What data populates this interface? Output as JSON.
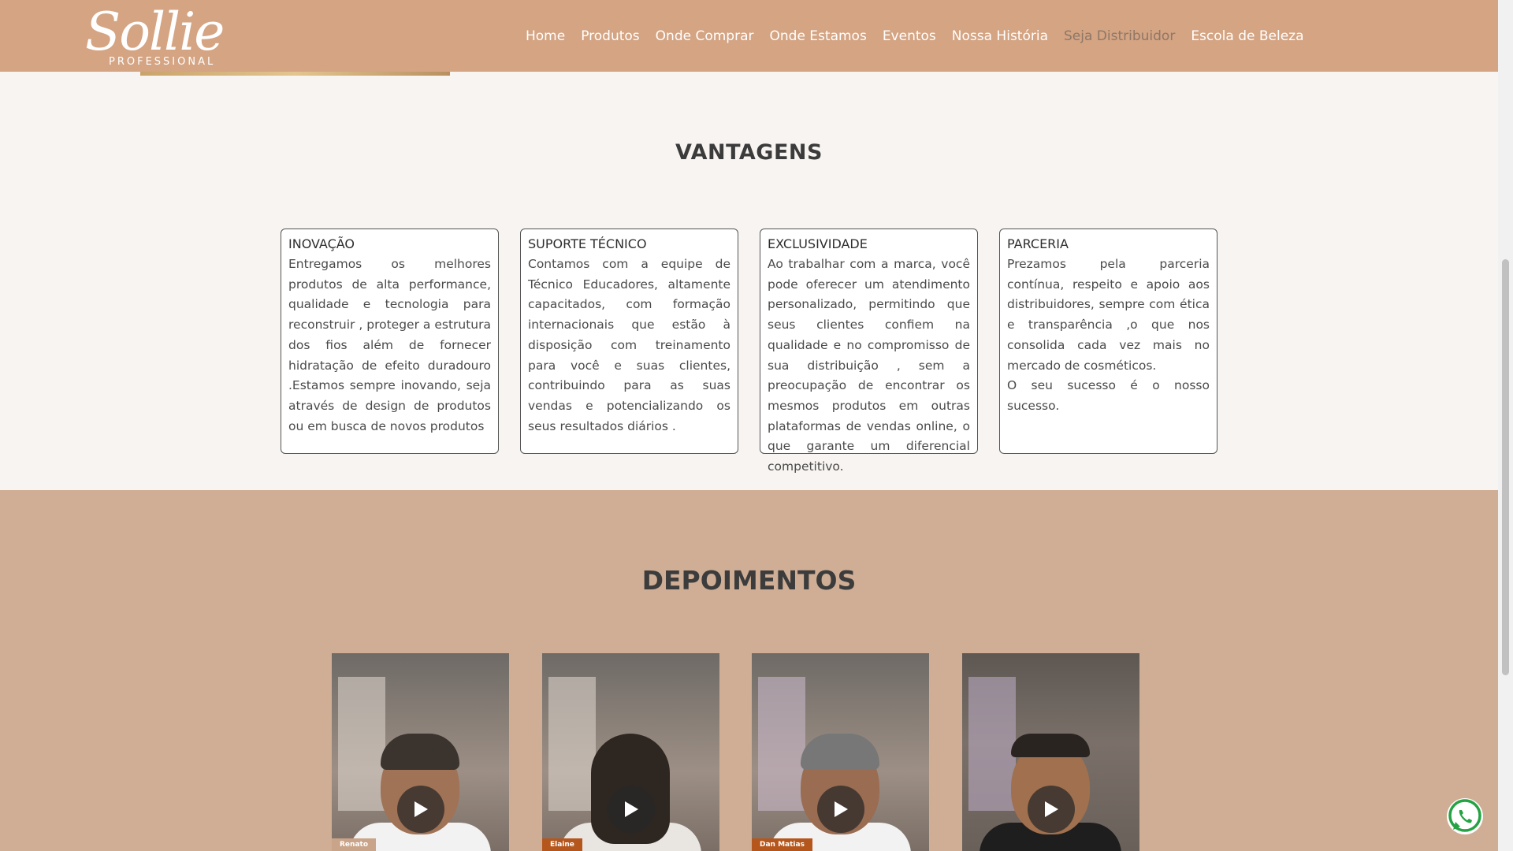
{
  "header": {
    "logo": {
      "word": "Sollie",
      "sub": "PROFESSIONAL"
    },
    "nav": [
      {
        "label": "Home"
      },
      {
        "label": "Produtos"
      },
      {
        "label": "Onde Comprar"
      },
      {
        "label": "Onde Estamos"
      },
      {
        "label": "Eventos"
      },
      {
        "label": "Nossa História"
      },
      {
        "label": "Seja Distribuidor"
      },
      {
        "label": "Escola de Beleza"
      }
    ],
    "active_item": "Seja Distribuidor"
  },
  "vantagens": {
    "title": "VANTAGENS",
    "cards": [
      {
        "title": "INOVAÇÃO",
        "text": "Entregamos os melhores produtos  de alta performance, qualidade e tecnologia para reconstruir , proteger a estrutura dos fios além de fornecer  hidratação de efeito duradouro  .Estamos sempre inovando, seja através de design de produtos ou em busca de novos produtos"
      },
      {
        "title": "SUPORTE TÉCNICO",
        "text": "Contamos com a  equipe de Técnico Educadores, altamente capacitados, com formação internacionais que  estão à disposição com treinamento para  você e suas clientes, contribuindo para as suas vendas e  potencializando os seus resultados diários ."
      },
      {
        "title": "EXCLUSIVIDADE",
        "text": "Ao trabalhar com a marca, você pode oferecer um atendimento personalizado, permitindo que seus clientes confiem na qualidade e no compromisso de sua distribuição , sem a preocupação de encontrar os mesmos produtos em outras plataformas  de vendas online, o que garante um diferencial competitivo."
      },
      {
        "title": "PARCERIA",
        "text": "Prezamos pela parceria  contínua, respeito e apoio aos distribuidores, sempre com ética e transparência ,o que nos consolida cada vez mais no mercado de cosméticos.",
        "text2": "O seu sucesso é o nosso sucesso."
      }
    ]
  },
  "depoimentos": {
    "title": "DEPOIMENTOS",
    "videos": [
      {
        "name": "Renato",
        "tag_color": "#c9a489",
        "icon": "play-icon"
      },
      {
        "name": "Elaine",
        "tag_color": "#b5561c",
        "icon": "play-icon"
      },
      {
        "name": "Dan Matias",
        "tag_color": "#b5561c",
        "icon": "play-icon"
      },
      {
        "name": "",
        "tag_color": "",
        "icon": "play-icon"
      }
    ]
  },
  "colors": {
    "header_bg": "#d4a483",
    "depo_bg": "#cfae95",
    "page_bg": "#f7f4f1"
  },
  "floating": {
    "icon": "whatsapp-icon"
  }
}
